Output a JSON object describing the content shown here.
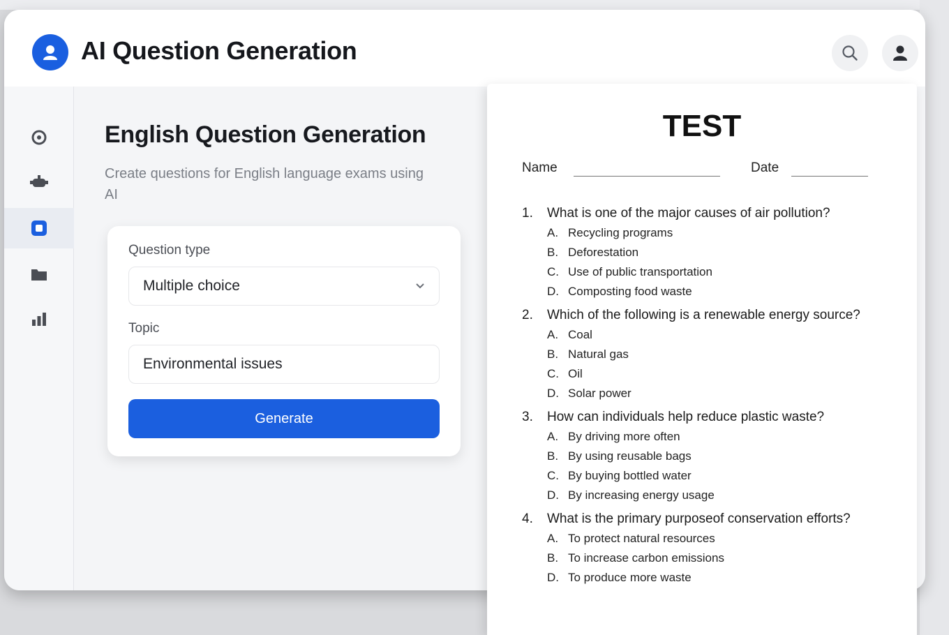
{
  "header": {
    "app_title": "AI Question Generation"
  },
  "sidebar": {
    "items": [
      {
        "name": "dashboard",
        "icon": "circle-icon"
      },
      {
        "name": "robot",
        "icon": "robot-icon"
      },
      {
        "name": "questions",
        "icon": "document-icon",
        "active": true
      },
      {
        "name": "folders",
        "icon": "folder-icon"
      },
      {
        "name": "analytics",
        "icon": "bar-chart-icon"
      }
    ]
  },
  "main": {
    "title": "English Question Generation",
    "subtitle": "Create questions for English language exams using AI",
    "form": {
      "question_type_label": "Question type",
      "question_type_value": "Multiple choice",
      "topic_label": "Topic",
      "topic_value": "Environmental issues",
      "generate_label": "Generate"
    }
  },
  "test": {
    "title": "TEST",
    "name_label": "Name",
    "date_label": "Date",
    "questions": [
      {
        "num": "1.",
        "text": "What is one of the major causes of air pollution?",
        "options": [
          {
            "letter": "A.",
            "text": "Recycling programs"
          },
          {
            "letter": "B.",
            "text": "Deforestation"
          },
          {
            "letter": "C.",
            "text": "Use of public transportation"
          },
          {
            "letter": "D.",
            "text": "Composting food waste"
          }
        ]
      },
      {
        "num": "2.",
        "text": "Which of the following is a renewable energy source?",
        "options": [
          {
            "letter": "A.",
            "text": "Coal"
          },
          {
            "letter": "B.",
            "text": "Natural gas"
          },
          {
            "letter": "C.",
            "text": "Oil"
          },
          {
            "letter": "D.",
            "text": "Solar power"
          }
        ]
      },
      {
        "num": "3.",
        "text": "How can individuals help reduce plastic waste?",
        "options": [
          {
            "letter": "A.",
            "text": "By driving more often"
          },
          {
            "letter": "B.",
            "text": "By using reusable bags"
          },
          {
            "letter": "C.",
            "text": "By buying bottled water"
          },
          {
            "letter": "D.",
            "text": "By increasing energy usage"
          }
        ]
      },
      {
        "num": "4.",
        "text": "What is the primary purposeof conservation efforts?",
        "options": [
          {
            "letter": "A.",
            "text": "To protect natural resources"
          },
          {
            "letter": "B.",
            "text": "To increase carbon emissions"
          },
          {
            "letter": "D.",
            "text": "To produce more waste"
          }
        ]
      }
    ]
  },
  "colors": {
    "accent": "#1b5fdf",
    "background": "#f4f5f7",
    "text": "#17191e"
  }
}
